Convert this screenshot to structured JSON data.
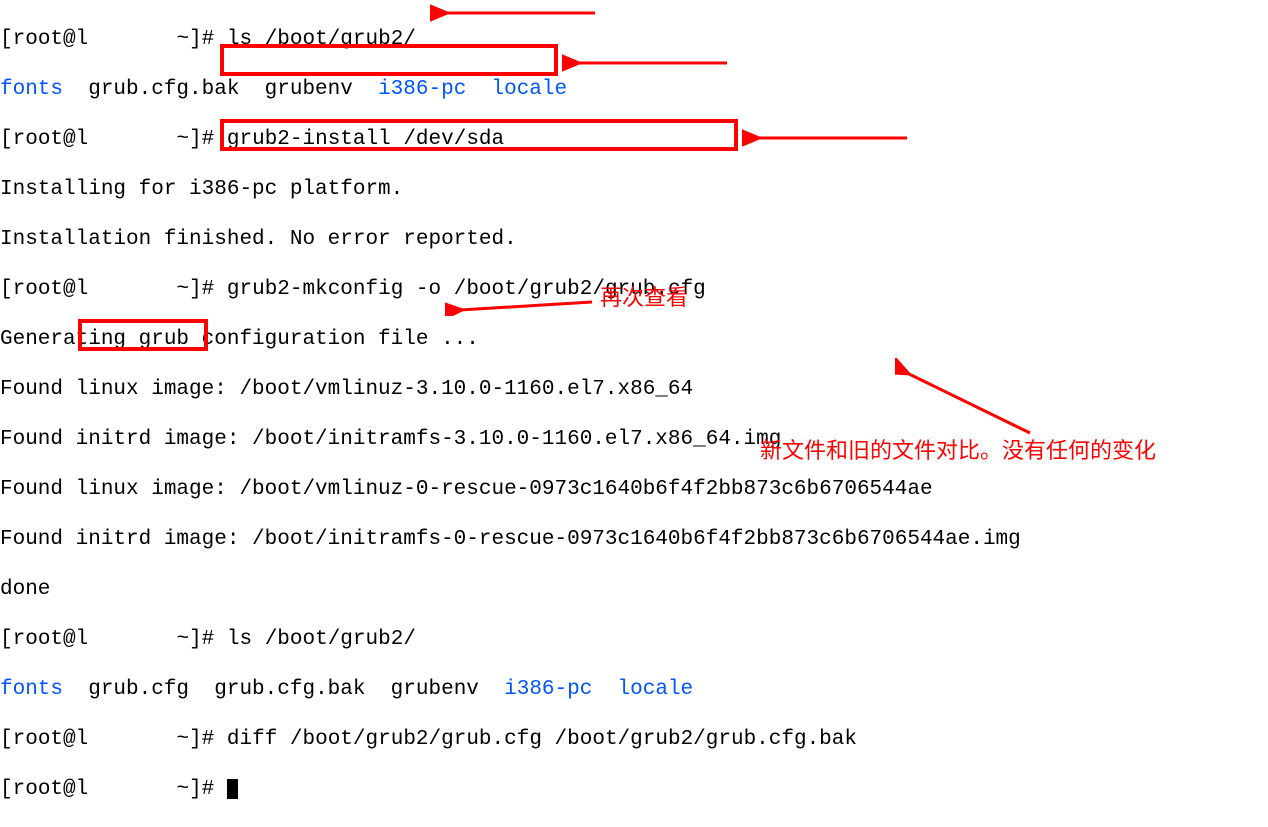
{
  "terminal": {
    "prompt_user": "root",
    "prompt_host_prefix": "l",
    "prompt_host_masked": "      ",
    "prompt_suffix": " ~]# ",
    "lines": {
      "l1_cmd": "ls /boot/grub2/",
      "l2_fonts": "fonts",
      "l2_rest": "  grub.cfg.bak  grubenv  ",
      "l2_i386": "i386-pc",
      "l2_locale": "  locale",
      "l3_cmd": "grub2-install /dev/sda",
      "l4": "Installing for i386-pc platform.",
      "l5": "Installation finished. No error reported.",
      "l6_cmd": "grub2-mkconfig -o /boot/grub2/grub.cfg",
      "l7": "Generating grub configuration file ...",
      "l8": "Found linux image: /boot/vmlinuz-3.10.0-1160.el7.x86_64",
      "l9": "Found initrd image: /boot/initramfs-3.10.0-1160.el7.x86_64.img",
      "l10": "Found linux image: /boot/vmlinuz-0-rescue-0973c1640b6f4f2bb873c6b6706544ae",
      "l11": "Found initrd image: /boot/initramfs-0-rescue-0973c1640b6f4f2bb873c6b6706544ae.img",
      "l12": "done",
      "l13_cmd": "ls /boot/grub2/",
      "l14_fonts": "fonts",
      "l14_grubcfg": "  grub.cfg  ",
      "l14_rest1": "grub.cfg.bak  grubenv  ",
      "l14_i386": "i386-pc",
      "l14_sp": "  ",
      "l14_locale": "locale",
      "l15_cmd": "diff /boot/grub2/grub.cfg /boot/grub2/grub.cfg.bak",
      "l16_cmd": ""
    }
  },
  "annotations": {
    "ann1": "再次查看",
    "ann2": "新文件和旧的文件对比。没有任何的变化"
  },
  "colors": {
    "red": "#ff0000",
    "blue": "#0055ff"
  }
}
